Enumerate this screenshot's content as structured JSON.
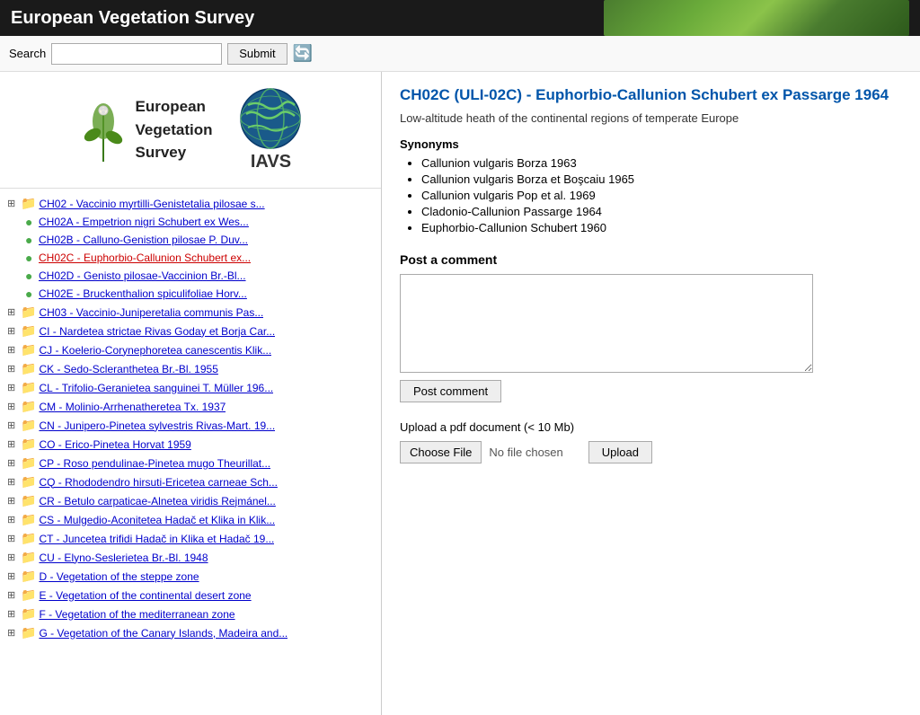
{
  "header": {
    "title": "European Vegetation Survey"
  },
  "search": {
    "label": "Search",
    "placeholder": "",
    "submit_label": "Submit"
  },
  "logo": {
    "evs_text": "European\nVegetation\nSurvey",
    "iavs_text": "IAVS"
  },
  "content": {
    "title": "CH02C (ULI-02C) - Euphorbio-Callunion Schubert ex Passarge 1964",
    "subtitle": "Low-altitude heath of the continental regions of temperate Europe",
    "synonyms_header": "Synonyms",
    "synonyms": [
      "Callunion vulgaris Borza 1963",
      "Callunion vulgaris Borza et Boşcaiu 1965",
      "Callunion vulgaris Pop et al. 1969",
      "Cladonio-Callunion Passarge 1964",
      "Euphorbio-Callunion Schubert 1960"
    ],
    "post_comment_header": "Post a comment",
    "post_comment_btn": "Post comment",
    "upload_header": "Upload a pdf document (< 10 Mb)",
    "choose_file_btn": "Choose File",
    "no_file_label": "No file chosen",
    "upload_btn": "Upload"
  },
  "tree": [
    {
      "id": "ch02",
      "indent": 0,
      "expand": "⊞",
      "folder": true,
      "text": "CH02 - Vaccinio myrtilli-Genistetalia pilosae s..."
    },
    {
      "id": "ch02a",
      "indent": 1,
      "dot": true,
      "text": "CH02A - Empetrion nigri Schubert ex Wes..."
    },
    {
      "id": "ch02b",
      "indent": 1,
      "dot": true,
      "text": "CH02B - Calluno-Genistion pilosae P. Duv..."
    },
    {
      "id": "ch02c",
      "indent": 1,
      "dot": true,
      "text": "CH02C - Euphorbio-Callunion Schubert ex...",
      "active": true
    },
    {
      "id": "ch02d",
      "indent": 1,
      "dot": true,
      "text": "CH02D - Genisto pilosae-Vaccinion Br.-Bl..."
    },
    {
      "id": "ch02e",
      "indent": 1,
      "dot": true,
      "text": "CH02E - Bruckenthalion spiculifoliae Horv..."
    },
    {
      "id": "ch03",
      "indent": 0,
      "expand": "⊞",
      "folder": true,
      "text": "CH03 - Vaccinio-Juniperetalia communis Pas..."
    },
    {
      "id": "cl",
      "indent": 0,
      "expand": "⊞",
      "folder": true,
      "text": "CI - Nardetea strictae Rivas Goday et Borja Car..."
    },
    {
      "id": "cj",
      "indent": 0,
      "expand": "⊞",
      "folder": true,
      "text": "CJ - Koelerio-Corynephoretea canescentis Klik..."
    },
    {
      "id": "ck",
      "indent": 0,
      "expand": "⊞",
      "folder": true,
      "text": "CK - Sedo-Scleranthetea Br.-Bl. 1955"
    },
    {
      "id": "cl2",
      "indent": 0,
      "expand": "⊞",
      "folder": true,
      "text": "CL - Trifolio-Geranietea sanguinei T. Müller 196..."
    },
    {
      "id": "cm",
      "indent": 0,
      "expand": "⊞",
      "folder": true,
      "text": "CM - Molinio-Arrhenatheretea Tx. 1937"
    },
    {
      "id": "cn",
      "indent": 0,
      "expand": "⊞",
      "folder": true,
      "text": "CN - Junipero-Pinetea sylvestris Rivas-Mart. 19..."
    },
    {
      "id": "co",
      "indent": 0,
      "expand": "⊞",
      "folder": true,
      "text": "CO - Erico-Pinetea Horvat 1959"
    },
    {
      "id": "cp",
      "indent": 0,
      "expand": "⊞",
      "folder": true,
      "text": "CP - Roso pendulinae-Pinetea mugo Theurillat..."
    },
    {
      "id": "cq",
      "indent": 0,
      "expand": "⊞",
      "folder": true,
      "text": "CQ - Rhododendro hirsuti-Ericetea carneae Sch..."
    },
    {
      "id": "cr",
      "indent": 0,
      "expand": "⊞",
      "folder": true,
      "text": "CR - Betulo carpaticae-Alnetea viridis Rejmánel..."
    },
    {
      "id": "cs",
      "indent": 0,
      "expand": "⊞",
      "folder": true,
      "text": "CS - Mulgedio-Aconitetea Hadač et Klika in Klik..."
    },
    {
      "id": "ct",
      "indent": 0,
      "expand": "⊞",
      "folder": true,
      "text": "CT - Juncetea trifidi Hadač in Klika et Hadač 19..."
    },
    {
      "id": "cu",
      "indent": 0,
      "expand": "⊞",
      "folder": true,
      "text": "CU - Elyno-Seslerietea Br.-Bl. 1948"
    },
    {
      "id": "d",
      "indent": 0,
      "expand": "⊞",
      "folder": true,
      "text": "D - Vegetation of the steppe zone"
    },
    {
      "id": "e",
      "indent": 0,
      "expand": "⊞",
      "folder": true,
      "text": "E - Vegetation of the continental desert zone"
    },
    {
      "id": "f",
      "indent": 0,
      "expand": "⊞",
      "folder": true,
      "text": "F - Vegetation of the mediterranean zone"
    },
    {
      "id": "g",
      "indent": 0,
      "expand": "⊞",
      "folder": true,
      "text": "G - Vegetation of the Canary Islands, Madeira and..."
    }
  ]
}
